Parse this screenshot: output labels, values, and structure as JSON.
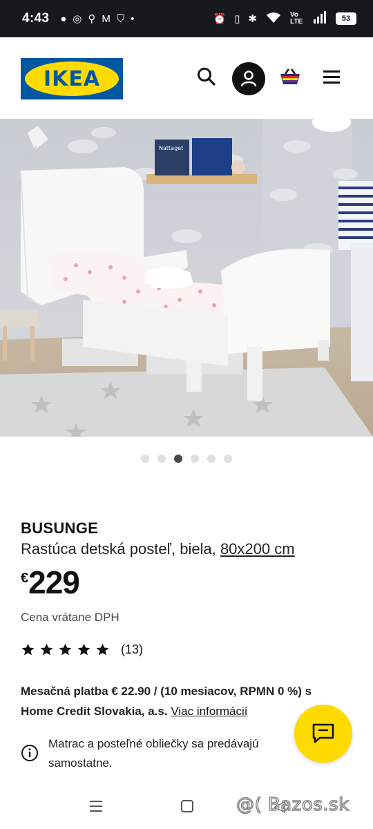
{
  "status_bar": {
    "time": "4:43",
    "network": "Vo LTE",
    "battery": "53"
  },
  "header": {
    "logo_text": "IKEA"
  },
  "gallery": {
    "book1_title": "Nattaget",
    "dot_count": 6,
    "active_dot": 3
  },
  "product": {
    "name": "BUSUNGE",
    "description": "Rastúca detská posteľ, biela,",
    "size": "80x200 cm",
    "currency": "€",
    "price": "229",
    "vat_note": "Cena vrátane DPH",
    "rating_stars": 5,
    "review_count": "(13)",
    "monthly_payment": "Mesačná platba € 22.90 / (10 mesiacov, RPMN 0 %) s Home Credit Slovakia, a.s.",
    "more_info_link": "Viac informácií",
    "notice": "Matrac a posteľné obliečky sa predávajú samostatne."
  },
  "watermark": "@( Bazos.sk",
  "colors": {
    "ikea_blue": "#0058a3",
    "ikea_yellow": "#ffdb00",
    "status_bg": "#17181c"
  }
}
